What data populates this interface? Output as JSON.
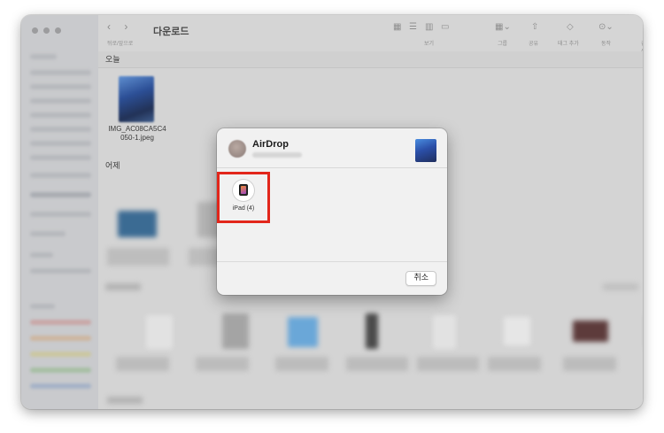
{
  "window": {
    "title": "다운로드"
  },
  "toolbar": {
    "nav_label": "뒤로/앞으로",
    "view_label": "보기",
    "group_label": "그룹",
    "share_label": "공유",
    "tag_label": "태그 추가",
    "action_label": "동작",
    "search_label": "검색"
  },
  "sections": {
    "today": "오늘",
    "yesterday": "어제"
  },
  "files": {
    "today": [
      {
        "name_line1": "IMG_AC08CA5C4",
        "name_line2": "050-1.jpeg"
      }
    ]
  },
  "airdrop": {
    "title": "AirDrop",
    "devices": [
      {
        "label": "iPad (4)",
        "icon": "ipad-icon"
      }
    ],
    "cancel_label": "취소"
  },
  "colors": {
    "highlight_box": "#e2261b",
    "window_bg": "#d4d4d4",
    "dialog_bg": "#f1f1f1"
  }
}
